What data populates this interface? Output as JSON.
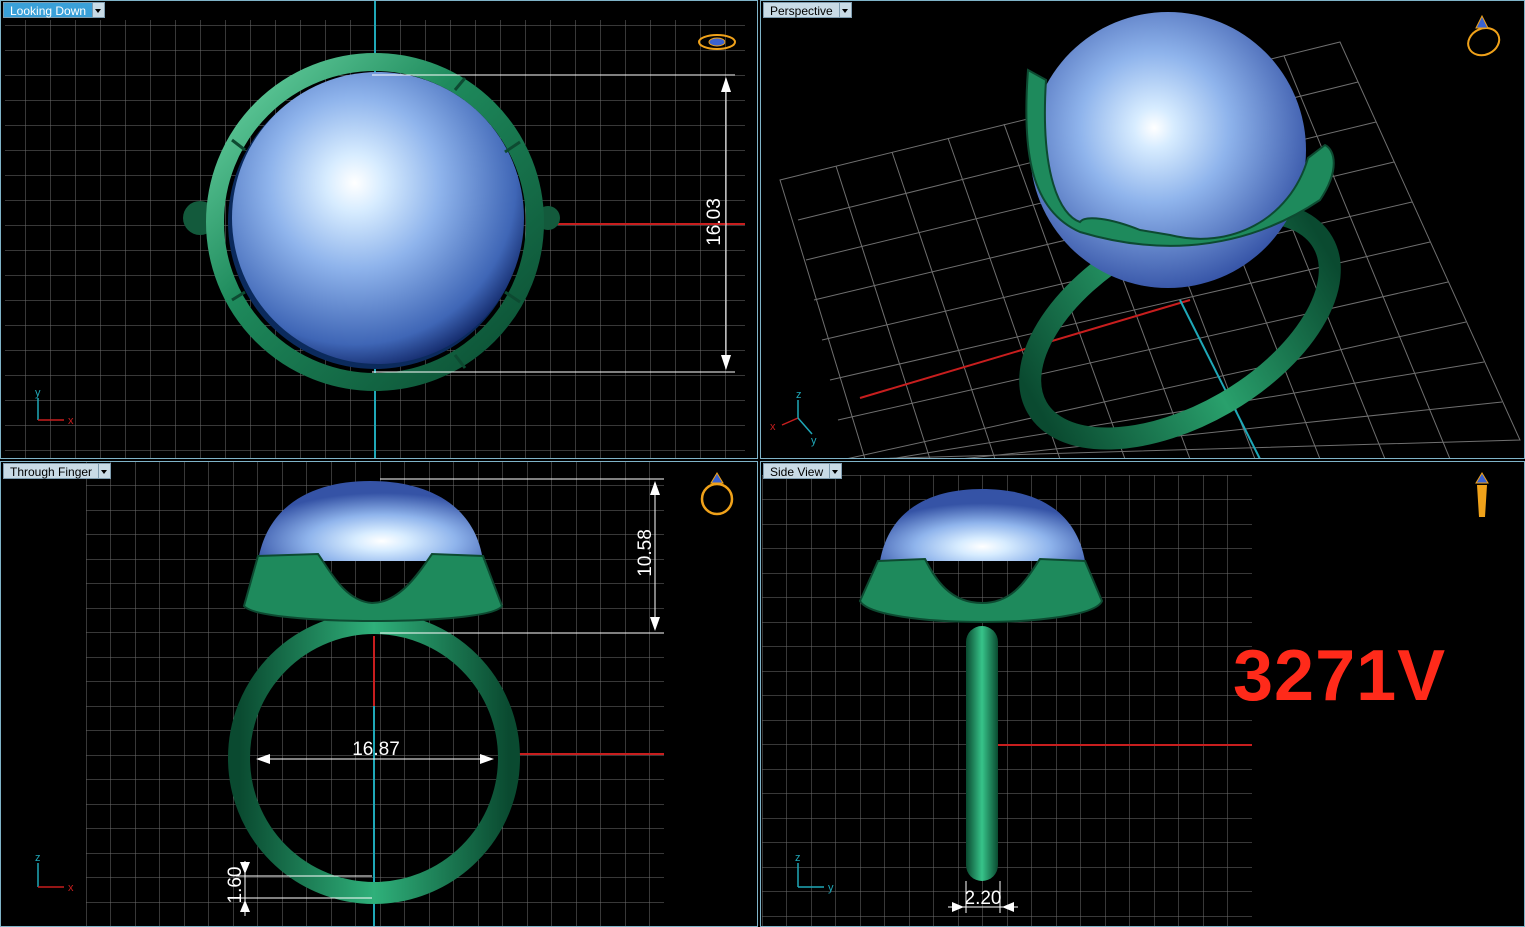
{
  "viewports": {
    "top_left": {
      "title": "Looking Down"
    },
    "top_right": {
      "title": "Perspective"
    },
    "bottom_left": {
      "title": "Through Finger"
    },
    "bottom_right": {
      "title": "Side View"
    }
  },
  "dimensions": {
    "height_top": "16.03",
    "height_stone": "10.58",
    "inner_diameter": "16.87",
    "band_thickness": "1.60",
    "band_width": "2.20"
  },
  "axes": {
    "top_left": {
      "vertical": "y",
      "horizontal": "x"
    },
    "top_right": {
      "vertical": "z",
      "left": "x",
      "right": "y"
    },
    "bottom_left": {
      "vertical": "z",
      "horizontal": "x"
    },
    "bottom_right": {
      "vertical": "z",
      "horizontal": "y"
    }
  },
  "model_code": "3271V",
  "colors": {
    "metal": "#1e8a5c",
    "stone": "#8fb4ec",
    "grid": "#6f6f6f",
    "axis_red": "#c81e1e",
    "axis_cyan": "#1fa8b8",
    "tab_active": "#3aa0d8",
    "code_red": "#ff2a1a"
  },
  "icons": [
    "ring-perspective-icon",
    "ring-front-icon",
    "ring-side-icon",
    "ring-top-icon"
  ]
}
